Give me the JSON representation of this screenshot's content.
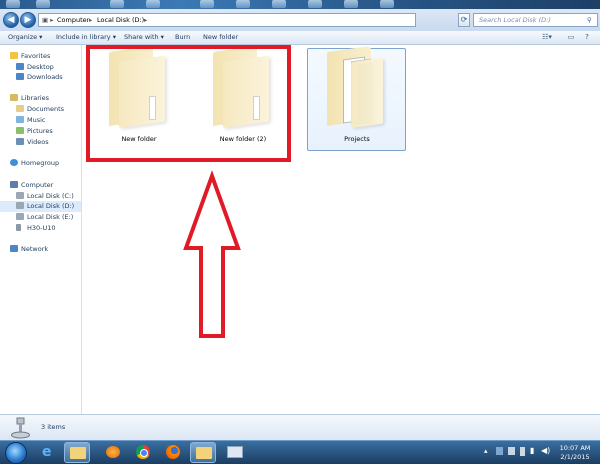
{
  "address": {
    "crumbs": [
      "Computer",
      "Local Disk (D:)"
    ],
    "search_placeholder": "Search Local Disk (D:)"
  },
  "toolbar": {
    "organize": "Organize ▾",
    "include_in_library": "Include in library ▾",
    "share_with": "Share with ▾",
    "burn": "Burn",
    "new_folder": "New folder"
  },
  "nav": {
    "favorites": "Favorites",
    "desktop": "Desktop",
    "downloads": "Downloads",
    "libraries": "Libraries",
    "documents": "Documents",
    "music": "Music",
    "pictures": "Pictures",
    "videos": "Videos",
    "homegroup": "Homegroup",
    "computer": "Computer",
    "disk_c": "Local Disk (C:)",
    "disk_d": "Local Disk (D:)",
    "disk_e": "Local Disk (E:)",
    "h30": "H30-U10",
    "network": "Network"
  },
  "folders": [
    {
      "label": "New folder"
    },
    {
      "label": "New folder (2)"
    },
    {
      "label": "Projects"
    }
  ],
  "status": {
    "count": "3 items"
  },
  "tray": {
    "time": "10:07 AM",
    "date": "2/1/2015"
  },
  "colors": {
    "highlight": "#e01a27",
    "arrow": "#e01a27"
  }
}
